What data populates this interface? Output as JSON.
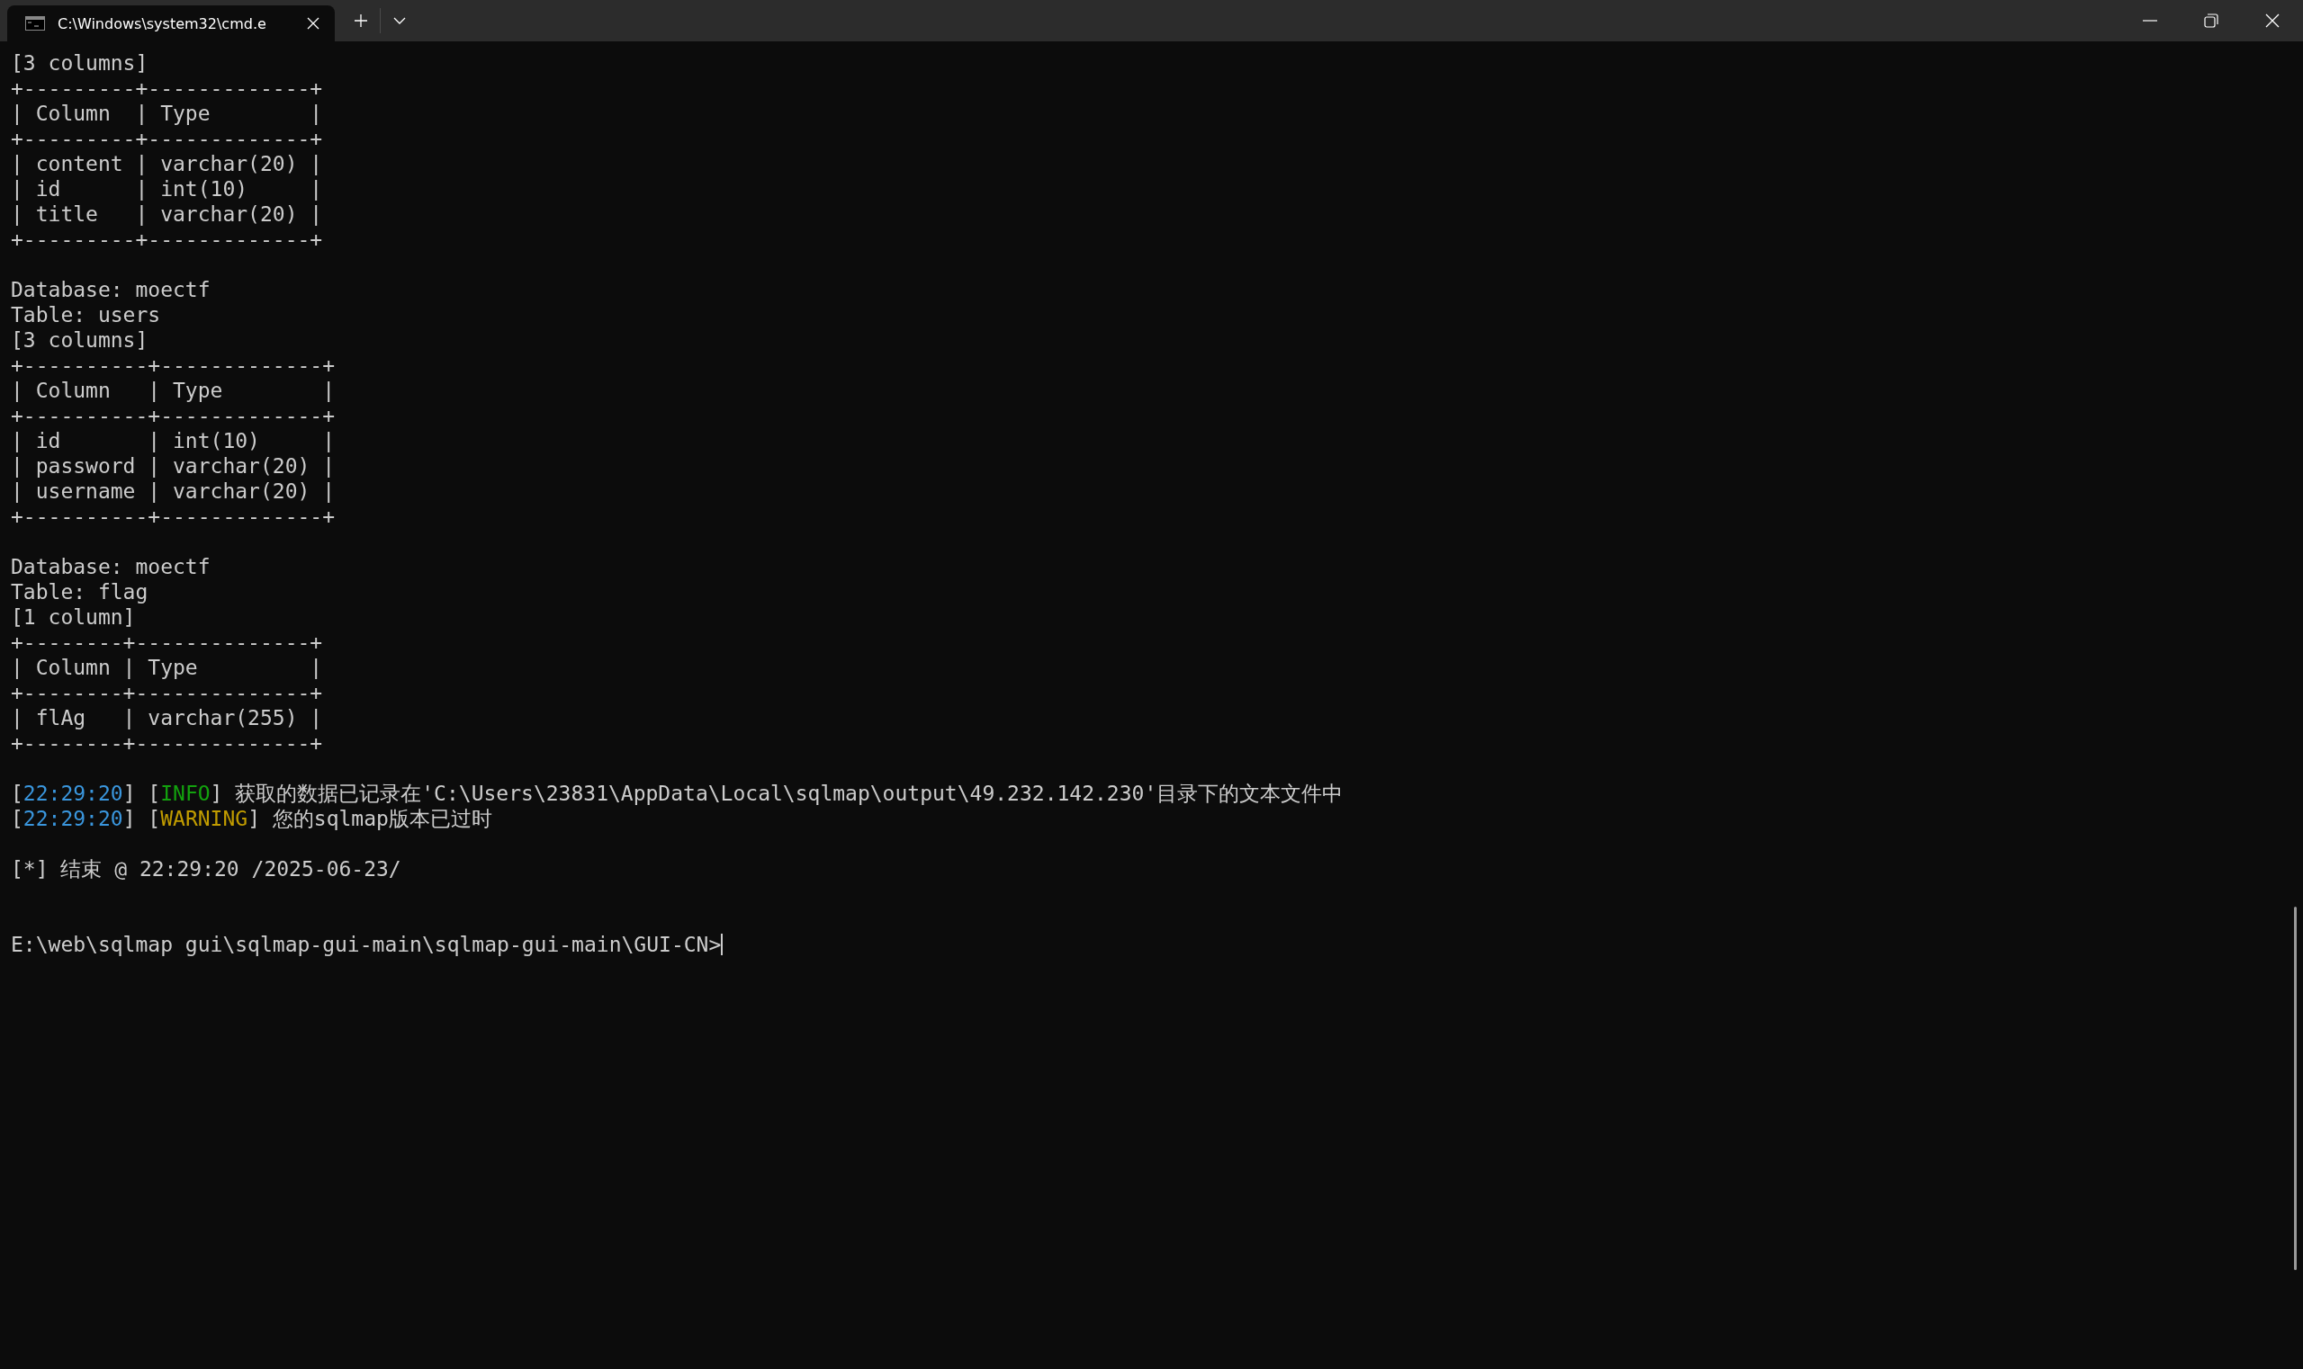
{
  "window": {
    "tab": {
      "title": "C:\\Windows\\system32\\cmd.e",
      "selected": true
    }
  },
  "terminal": {
    "lines": [
      {
        "kind": "text",
        "text": "[3 columns]"
      },
      {
        "kind": "text",
        "text": "+---------+-------------+"
      },
      {
        "kind": "text",
        "text": "| Column  | Type        |"
      },
      {
        "kind": "text",
        "text": "+---------+-------------+"
      },
      {
        "kind": "text",
        "text": "| content | varchar(20) |"
      },
      {
        "kind": "text",
        "text": "| id      | int(10)     |"
      },
      {
        "kind": "text",
        "text": "| title   | varchar(20) |"
      },
      {
        "kind": "text",
        "text": "+---------+-------------+"
      },
      {
        "kind": "blank"
      },
      {
        "kind": "text",
        "text": "Database: moectf"
      },
      {
        "kind": "text",
        "text": "Table: users"
      },
      {
        "kind": "text",
        "text": "[3 columns]"
      },
      {
        "kind": "text",
        "text": "+----------+-------------+"
      },
      {
        "kind": "text",
        "text": "| Column   | Type        |"
      },
      {
        "kind": "text",
        "text": "+----------+-------------+"
      },
      {
        "kind": "text",
        "text": "| id       | int(10)     |"
      },
      {
        "kind": "text",
        "text": "| password | varchar(20) |"
      },
      {
        "kind": "text",
        "text": "| username | varchar(20) |"
      },
      {
        "kind": "text",
        "text": "+----------+-------------+"
      },
      {
        "kind": "blank"
      },
      {
        "kind": "text",
        "text": "Database: moectf"
      },
      {
        "kind": "text",
        "text": "Table: flag"
      },
      {
        "kind": "text",
        "text": "[1 column]"
      },
      {
        "kind": "text",
        "text": "+--------+--------------+"
      },
      {
        "kind": "text",
        "text": "| Column | Type         |"
      },
      {
        "kind": "text",
        "text": "+--------+--------------+"
      },
      {
        "kind": "text",
        "text": "| flAg   | varchar(255) |"
      },
      {
        "kind": "text",
        "text": "+--------+--------------+"
      },
      {
        "kind": "blank"
      },
      {
        "kind": "log",
        "segments": [
          {
            "kind": "plain",
            "text": "["
          },
          {
            "kind": "time",
            "text": "22:29:20"
          },
          {
            "kind": "plain",
            "text": "] ["
          },
          {
            "kind": "info",
            "text": "INFO"
          },
          {
            "kind": "plain",
            "text": "] 获取的数据已记录在'C:\\Users\\23831\\AppData\\Local\\sqlmap\\output\\49.232.142.230'目录下的文本文件中"
          }
        ]
      },
      {
        "kind": "log",
        "segments": [
          {
            "kind": "plain",
            "text": "["
          },
          {
            "kind": "time",
            "text": "22:29:20"
          },
          {
            "kind": "plain",
            "text": "] ["
          },
          {
            "kind": "warning",
            "text": "WARNING"
          },
          {
            "kind": "plain",
            "text": "] 您的sqlmap版本已过时"
          }
        ]
      },
      {
        "kind": "blank"
      },
      {
        "kind": "text",
        "text": "[*] 结束 @ 22:29:20 /2025-06-23/"
      },
      {
        "kind": "blank"
      },
      {
        "kind": "blank"
      },
      {
        "kind": "prompt",
        "text": "E:\\web\\sqlmap gui\\sqlmap-gui-main\\sqlmap-gui-main\\GUI-CN>"
      }
    ]
  }
}
